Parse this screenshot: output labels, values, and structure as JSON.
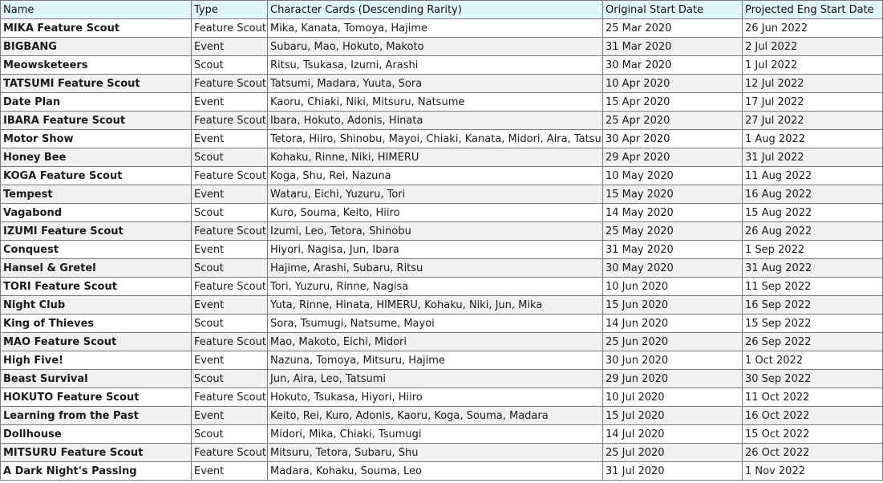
{
  "columns": [
    "Name",
    "Type",
    "Character Cards (Descending Rarity)",
    "Original Start Date",
    "Projected Eng Start Date"
  ],
  "rows": [
    [
      "MIKA Feature Scout",
      "Feature Scout",
      "Mika, Kanata, Tomoya, Hajime",
      "25 Mar 2020",
      "26 Jun 2022"
    ],
    [
      "BIGBANG",
      "Event",
      "Subaru, Mao, Hokuto, Makoto",
      "31 Mar 2020",
      "2 Jul 2022"
    ],
    [
      "Meowsketeers",
      "Scout",
      "Ritsu, Tsukasa, Izumi, Arashi",
      "30 Mar 2020",
      "1 Jul 2022"
    ],
    [
      "TATSUMI Feature Scout",
      "Feature Scout",
      "Tatsumi, Madara, Yuuta, Sora",
      "10 Apr 2020",
      "12 Jul 2022"
    ],
    [
      "Date Plan",
      "Event",
      "Kaoru, Chiaki, Niki, Mitsuru, Natsume",
      "15 Apr 2020",
      "17 Jul 2022"
    ],
    [
      "IBARA Feature Scout",
      "Feature Scout",
      "Ibara, Hokuto, Adonis, Hinata",
      "25 Apr 2020",
      "27 Jul 2022"
    ],
    [
      "Motor Show",
      "Event",
      "Tetora, Hiiro, Shinobu, Mayoi, Chiaki, Kanata, Midori, Aira, Tatsumi",
      "30 Apr 2020",
      "1 Aug 2022"
    ],
    [
      "Honey Bee",
      "Scout",
      "Kohaku, Rinne, Niki, HIMERU",
      "29 Apr 2020",
      "31 Jul 2022"
    ],
    [
      "KOGA Feature Scout",
      "Feature Scout",
      "Koga, Shu, Rei, Nazuna",
      "10 May 2020",
      "11 Aug 2022"
    ],
    [
      "Tempest",
      "Event",
      "Wataru, Eichi, Yuzuru, Tori",
      "15 May 2020",
      "16 Aug 2022"
    ],
    [
      "Vagabond",
      "Scout",
      "Kuro, Souma, Keito, Hiiro",
      "14 May 2020",
      "15 Aug 2022"
    ],
    [
      "IZUMI Feature Scout",
      "Feature Scout",
      "Izumi, Leo, Tetora, Shinobu",
      "25 May 2020",
      "26 Aug 2022"
    ],
    [
      "Conquest",
      "Event",
      "Hiyori, Nagisa, Jun, Ibara",
      "31 May 2020",
      "1 Sep 2022"
    ],
    [
      "Hansel & Gretel",
      "Scout",
      "Hajime, Arashi, Subaru, Ritsu",
      "30 May 2020",
      "31 Aug 2022"
    ],
    [
      "TORI Feature Scout",
      "Feature Scout",
      "Tori, Yuzuru, Rinne, Nagisa",
      "10 Jun 2020",
      "11 Sep 2022"
    ],
    [
      "Night Club",
      "Event",
      "Yuta, Rinne, Hinata, HIMERU, Kohaku, Niki, Jun, Mika",
      "15 Jun 2020",
      "16 Sep 2022"
    ],
    [
      "King of Thieves",
      "Scout",
      "Sora, Tsumugi, Natsume, Mayoi",
      "14 Jun 2020",
      "15 Sep 2022"
    ],
    [
      "MAO Feature Scout",
      "Feature Scout",
      "Mao, Makoto, Eichi, Midori",
      "25 Jun 2020",
      "26 Sep 2022"
    ],
    [
      "High Five!",
      "Event",
      "Nazuna, Tomoya, Mitsuru, Hajime",
      "30 Jun 2020",
      "1 Oct 2022"
    ],
    [
      "Beast Survival",
      "Scout",
      "Jun, Aira, Leo, Tatsumi",
      "29 Jun 2020",
      "30 Sep 2022"
    ],
    [
      "HOKUTO Feature Scout",
      "Feature Scout",
      "Hokuto, Tsukasa, Hiyori, Hiiro",
      "10 Jul 2020",
      "11 Oct 2022"
    ],
    [
      "Learning from the Past",
      "Event",
      "Keito, Rei, Kuro, Adonis, Kaoru, Koga, Souma, Madara",
      "15 Jul 2020",
      "16 Oct 2022"
    ],
    [
      "Dollhouse",
      "Scout",
      "Midori, Mika, Chiaki, Tsumugi",
      "14 Jul 2020",
      "15 Oct 2022"
    ],
    [
      "MITSURU Feature Scout",
      "Feature Scout",
      "Mitsuru, Tetora, Subaru, Shu",
      "25 Jul 2020",
      "26 Oct 2022"
    ],
    [
      "A Dark Night's Passing",
      "Event",
      "Madara, Kohaku, Souma, Leo",
      "31 Jul 2020",
      "1 Nov 2022"
    ]
  ],
  "colors": {
    "header_bg": "#dff5fa",
    "row_alt_bg": "#f0f0f0",
    "border": "#7a7a7a"
  }
}
